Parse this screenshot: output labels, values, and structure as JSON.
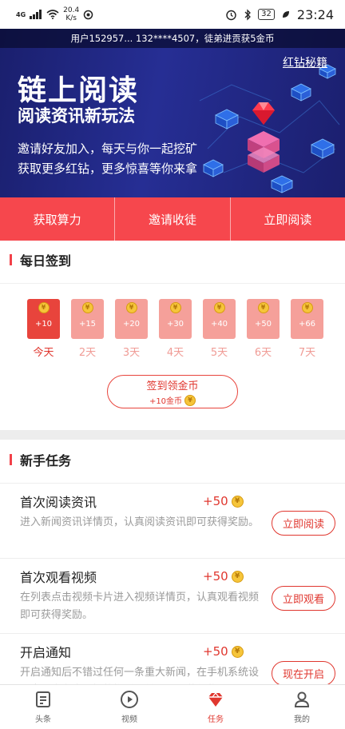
{
  "status_bar": {
    "signal": "4G",
    "speed_value": "20.4",
    "speed_unit": "K/s",
    "battery": "32",
    "time": "23:24"
  },
  "banner": {
    "ticker": "用户152957... 132****4507，徒弟进贡获5金币",
    "treasure_link": "红钻秘籍",
    "title": "链上阅读",
    "subtitle": "阅读资讯新玩法",
    "line1": "邀请好友加入，每天与你一起挖矿",
    "line2": "获取更多红钻，更多惊喜等你来拿"
  },
  "actions": [
    {
      "label": "获取算力"
    },
    {
      "label": "邀请收徒"
    },
    {
      "label": "立即阅读"
    }
  ],
  "daily_signin": {
    "title": "每日签到",
    "coin_symbol": "¥",
    "days": [
      {
        "amount": "+10",
        "label": "今天"
      },
      {
        "amount": "+15",
        "label": "2天"
      },
      {
        "amount": "+20",
        "label": "3天"
      },
      {
        "amount": "+30",
        "label": "4天"
      },
      {
        "amount": "+40",
        "label": "5天"
      },
      {
        "amount": "+50",
        "label": "6天"
      },
      {
        "amount": "+66",
        "label": "7天"
      }
    ],
    "button_main": "签到领金币",
    "button_sub": "+10金币"
  },
  "newbie_tasks": {
    "title": "新手任务",
    "items": [
      {
        "title": "首次阅读资讯",
        "reward": "+50",
        "desc": "进入新闻资讯详情页，认真阅读资讯即可获得奖励。",
        "button": "立即阅读"
      },
      {
        "title": "首次观看视频",
        "reward": "+50",
        "desc": "在列表点击视频卡片进入视频详情页，认真观看视频即可获得奖励。",
        "button": "立即观看"
      },
      {
        "title": "开启通知",
        "reward": "+50",
        "desc": "开启通知后不错过任何一条重大新闻，在手机系统设置中开启允许通知的推送开关，即可获得奖励。",
        "button": "现在开启"
      }
    ]
  },
  "bottom_nav": [
    {
      "label": "头条",
      "icon": "article-icon"
    },
    {
      "label": "视频",
      "icon": "play-icon"
    },
    {
      "label": "任务",
      "icon": "diamond-icon"
    },
    {
      "label": "我的",
      "icon": "person-icon"
    }
  ],
  "colors": {
    "accent": "#e0372f",
    "action_bar": "#f6474d",
    "banner_bg": "#262e94",
    "coin": "#f6c53a"
  }
}
